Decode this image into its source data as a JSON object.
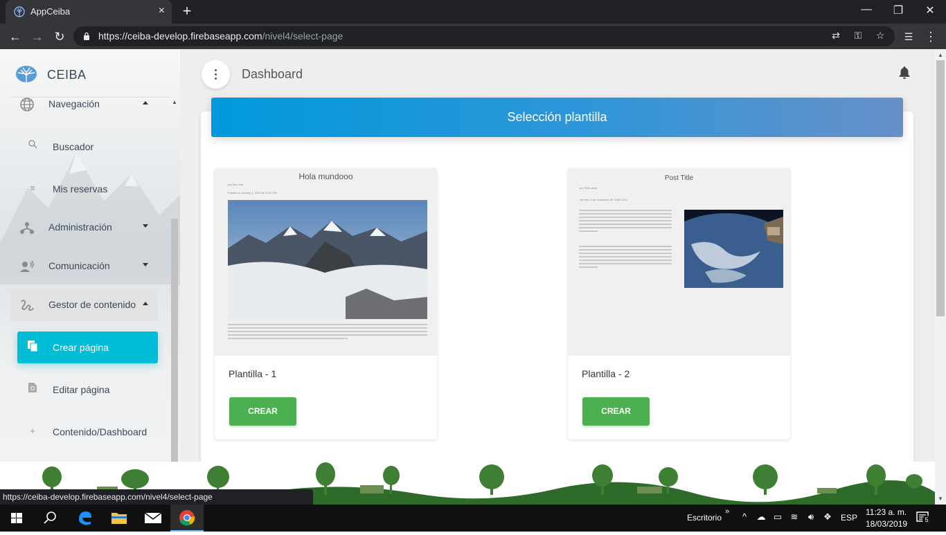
{
  "browser": {
    "tab_title": "AppCeiba",
    "tab_close": "×",
    "new_tab": "+",
    "url_host": "https://ceiba-develop.firebaseapp.com",
    "url_path": "/nivel4/select-page",
    "status_url": "https://ceiba-develop.firebaseapp.com/nivel4/select-page"
  },
  "sidebar": {
    "brand": "CEIBA",
    "items": [
      {
        "label": "Navegación",
        "icon": "globe-icon",
        "caret": "up"
      },
      {
        "label": "Buscador",
        "icon": "search-icon"
      },
      {
        "label": "Mis reservas",
        "icon": "list-icon"
      },
      {
        "label": "Administración",
        "icon": "network-icon",
        "caret": "down"
      },
      {
        "label": "Comunicación",
        "icon": "record-voice-icon",
        "caret": "down"
      },
      {
        "label": "Gestor de contenido",
        "icon": "gesture-icon",
        "caret": "up"
      },
      {
        "label": "Crear página",
        "icon": "file-copy-icon",
        "active": true
      },
      {
        "label": "Editar página",
        "icon": "edit-file-icon"
      },
      {
        "label": "Contenido/Dashboard",
        "icon": "plus-icon"
      }
    ]
  },
  "topnav": {
    "title": "Dashboard"
  },
  "card": {
    "header": "Selección plantilla",
    "templates": [
      {
        "name": "Plantilla - 1",
        "button": "CREAR",
        "preview": {
          "title": "Hola mundooo",
          "author": "por jhon doe",
          "date": "Posted on January 1, 2019 at 12:00 PM"
        }
      },
      {
        "name": "Plantilla - 2",
        "button": "CREAR",
        "preview": {
          "title": "Post Title",
          "author": "por Start autor",
          "date": "viernes, 9 de noviembre de 2018 12:31"
        }
      }
    ]
  },
  "taskbar": {
    "escritorio": "Escritorio",
    "lang": "ESP",
    "time": "11:23 a. m.",
    "date": "18/03/2019",
    "notifications": "5"
  },
  "colors": {
    "accent": "#00bcd4",
    "header_start": "#0099dc",
    "header_end": "#6790c8",
    "button_green": "#4caf50"
  }
}
